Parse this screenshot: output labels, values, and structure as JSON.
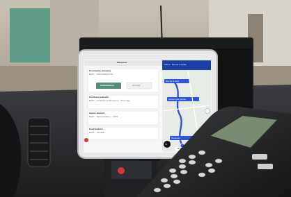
{
  "tablet": {
    "header": "Missions",
    "cards": [
      {
        "title": "Prochaine mission",
        "line": "BAPT - RÉCUPÉRATION"
      },
      {
        "title": "Position actuelle",
        "line": "BAPT - Ambulance Plouzané - Toulouse"
      },
      {
        "title": "Appel départ",
        "line": "BAPT - Récupération - 1006"
      },
      {
        "title": "Destination",
        "line": "BAPT - GLAIZE"
      }
    ],
    "buttons": [
      "Commencer",
      "Annuler"
    ],
    "map": {
      "banner": "100 m · Tourner à droite",
      "route_labels": [
        "Rue de la Gare",
        "Avenue Jean Jaurès",
        "Boulevard"
      ],
      "eta": "10:35",
      "speed": "30"
    }
  },
  "colors": {
    "route": "#2f55d8",
    "banner": "#1f3fa8",
    "accent_button": "#4f8f7c",
    "stop_icon": "#d43c2c"
  }
}
